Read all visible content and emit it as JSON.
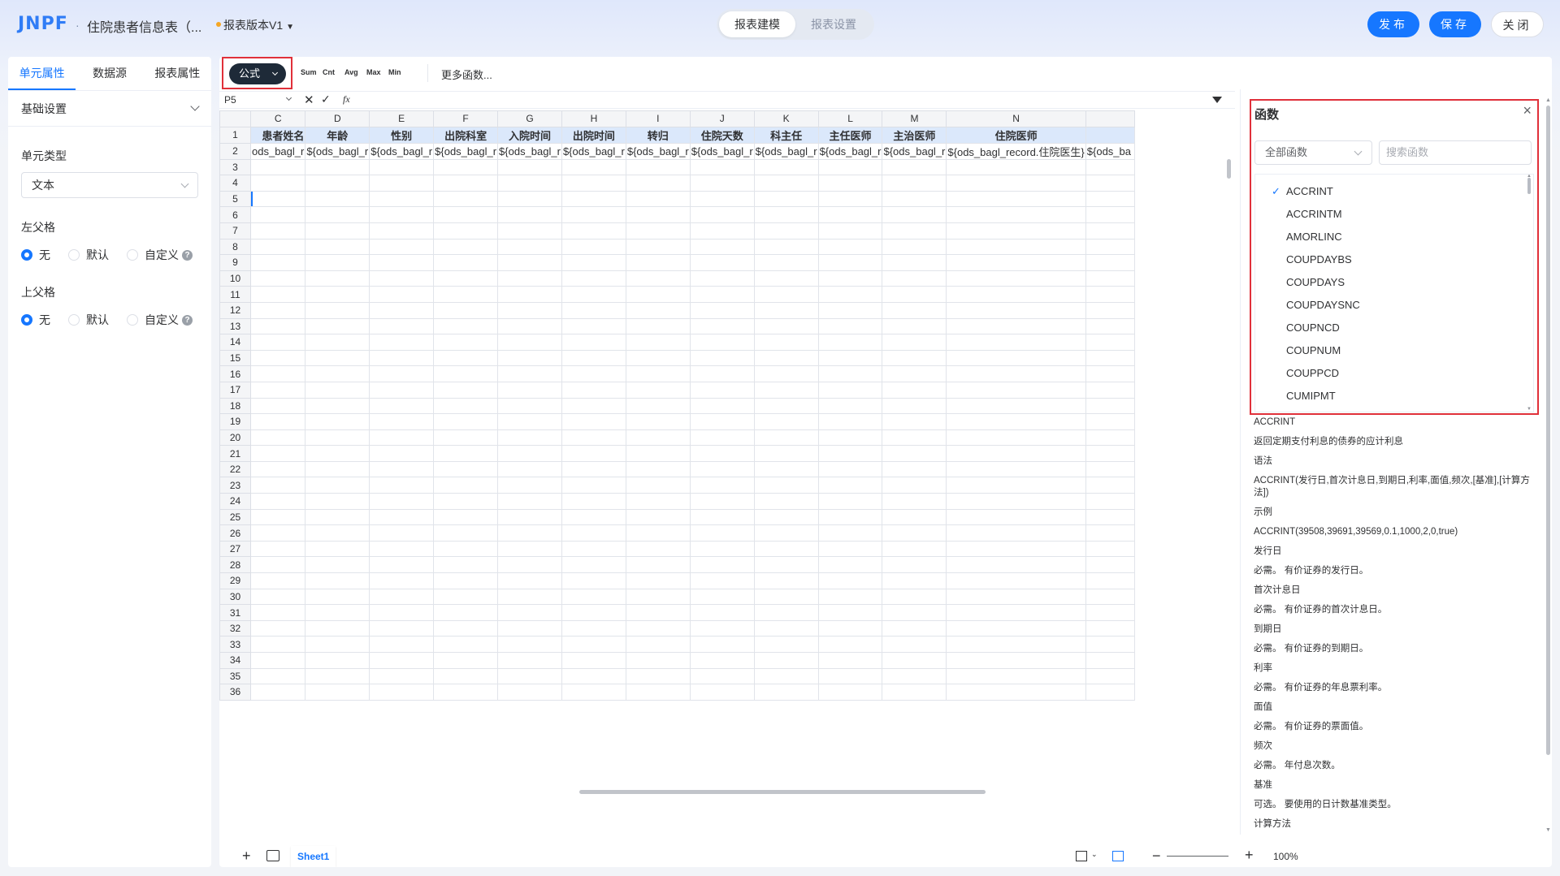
{
  "header": {
    "logo": "JNPF",
    "doc_title": "住院患者信息表（...",
    "version": "报表版本V1",
    "mode_tabs": [
      "报表建模",
      "报表设置"
    ],
    "publish_label": "发布",
    "save_label": "保存",
    "close_label": "关闭"
  },
  "left_panel": {
    "tabs": [
      "单元属性",
      "数据源",
      "报表属性"
    ],
    "section_title": "基础设置",
    "cell_type_label": "单元类型",
    "cell_type_value": "文本",
    "left_parent_label": "左父格",
    "top_parent_label": "上父格",
    "radio_options": [
      "无",
      "默认",
      "自定义"
    ],
    "left_parent_selected": "无",
    "top_parent_selected": "无"
  },
  "toolbar": {
    "formula_label": "公式",
    "quick_functions": [
      "Sum",
      "Cnt",
      "Avg",
      "Max",
      "Min"
    ],
    "more_functions_label": "更多函数..."
  },
  "formula_bar": {
    "cell_ref": "P5",
    "fx_label": "fx"
  },
  "sheet": {
    "columns": [
      "C",
      "D",
      "E",
      "F",
      "G",
      "H",
      "I",
      "J",
      "K",
      "L",
      "M",
      "N",
      ""
    ],
    "header_row": [
      "患者姓名",
      "年龄",
      "性别",
      "出院科室",
      "入院时间",
      "出院时间",
      "转归",
      "住院天数",
      "科主任",
      "主任医师",
      "主治医师",
      "住院医师",
      ""
    ],
    "value_row": [
      "ods_bagl_r",
      "${ods_bagl_r",
      "${ods_bagl_r",
      "${ods_bagl_r",
      "${ods_bagl_r",
      "${ods_bagl_r",
      "${ods_bagl_r",
      "${ods_bagl_r",
      "${ods_bagl_r",
      "${ods_bagl_r",
      "${ods_bagl_r",
      "${ods_bagl_record.住院医生}",
      "${ods_ba"
    ],
    "row_numbers": [
      "1",
      "2",
      "3",
      "4",
      "5",
      "6",
      "7",
      "8",
      "9",
      "10",
      "11",
      "12",
      "13",
      "14",
      "15",
      "16",
      "17",
      "18",
      "19",
      "20",
      "21",
      "22",
      "23",
      "24",
      "25",
      "26",
      "27",
      "28",
      "29",
      "30",
      "31",
      "32",
      "33",
      "34",
      "35",
      "36"
    ],
    "selected_row": "5"
  },
  "bottom_bar": {
    "sheet_tab": "Sheet1",
    "zoom": "100%"
  },
  "function_panel": {
    "title": "函数",
    "category": "全部函数",
    "search_placeholder": "搜索函数",
    "functions": [
      "ACCRINT",
      "ACCRINTM",
      "AMORLINC",
      "COUPDAYBS",
      "COUPDAYS",
      "COUPDAYSNC",
      "COUPNCD",
      "COUPNUM",
      "COUPPCD",
      "CUMIPMT"
    ],
    "selected_function": "ACCRINT",
    "description": [
      "ACCRINT",
      "返回定期支付利息的债券的应计利息",
      "语法",
      "ACCRINT(发行日,首次计息日,到期日,利率,面值,频次,[基准],[计算方法])",
      "示例",
      "ACCRINT(39508,39691,39569,0.1,1000,2,0,true)",
      "发行日",
      "必需。 有价证券的发行日。",
      "首次计息日",
      "必需。 有价证券的首次计息日。",
      "到期日",
      "必需。 有价证券的到期日。",
      "利率",
      "必需。 有价证券的年息票利率。",
      "面值",
      "必需。 有价证券的票面值。",
      "频次",
      "必需。 年付息次数。",
      "基准",
      "可选。 要使用的日计数基准类型。",
      "计算方法"
    ]
  },
  "colors": {
    "primary": "#1677ff",
    "highlight_border": "#e0303a",
    "header_cell_bg": "#dbe8fb"
  }
}
